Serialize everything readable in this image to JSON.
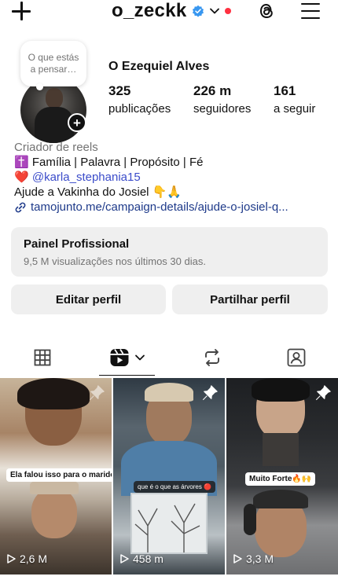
{
  "header": {
    "username": "o_zeckk",
    "icons": [
      "plus-icon",
      "verified-badge-icon",
      "chevron-down-icon",
      "threads-icon",
      "hamburger-menu-icon"
    ],
    "verified_color": "#3897f0",
    "notification_color": "#ff3040"
  },
  "profile": {
    "note_placeholder": "O que estás a pensar…",
    "full_name": "O Ezequiel Alves",
    "stats": [
      {
        "value": "325",
        "label": "publicações"
      },
      {
        "value": "226 m",
        "label": "seguidores"
      },
      {
        "value": "161",
        "label": "a seguir"
      }
    ]
  },
  "bio": {
    "category": "Criador de reels",
    "line1": "✝️ Família | Palavra | Propósito | Fé",
    "heart": "❤️",
    "mention": "@karla_stephania15",
    "line3": "Ajude a Vakinha do Josiel 👇🙏",
    "link": "tamojunto.me/campaign-details/ajude-o-josiel-q..."
  },
  "dashboard": {
    "title": "Painel Profissional",
    "subtitle": "9,5 M visualizações nos últimos 30 dias."
  },
  "buttons": {
    "edit": "Editar perfil",
    "share": "Partilhar perfil"
  },
  "tabs": [
    {
      "name": "posts-grid-icon",
      "active": false
    },
    {
      "name": "reels-icon",
      "active": true
    },
    {
      "name": "reposts-icon",
      "active": false
    },
    {
      "name": "tagged-icon",
      "active": false
    }
  ],
  "reels": [
    {
      "caption": "Ela falou isso para o marido 😮",
      "views": "2,6 M",
      "pinned": true
    },
    {
      "caption": "que é o que as árvores 🔴",
      "views": "458 m",
      "pinned": true
    },
    {
      "caption": "Muito Forte🔥🙌",
      "views": "3,3 M",
      "pinned": true
    }
  ]
}
